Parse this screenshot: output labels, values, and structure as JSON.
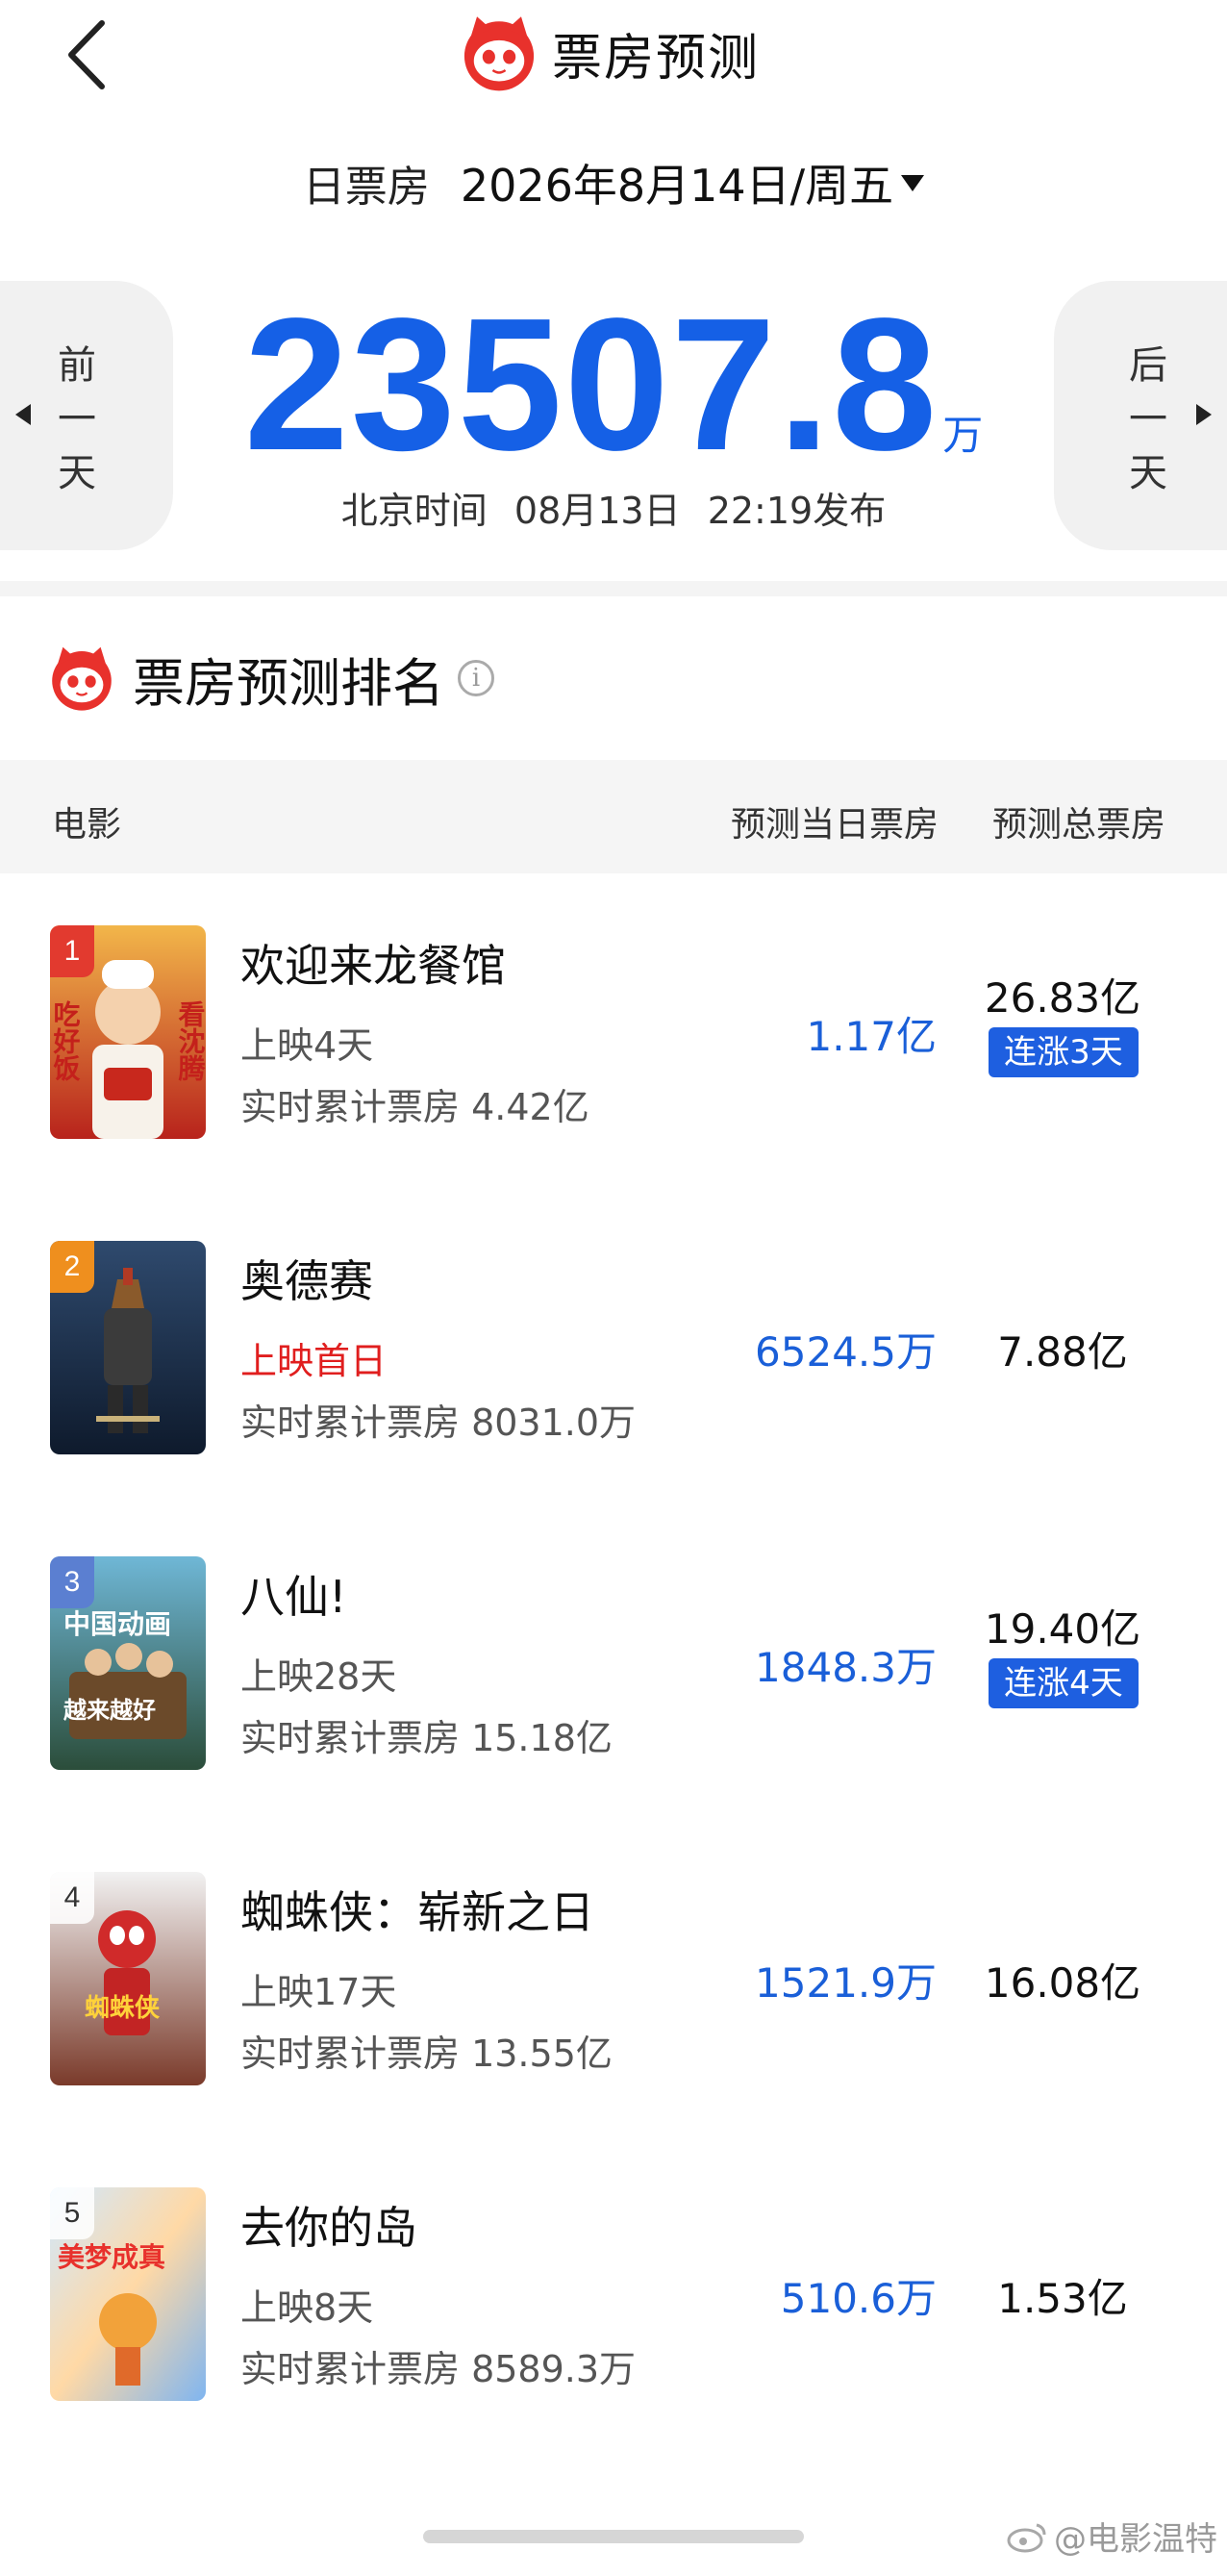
{
  "header": {
    "title": "票房预测"
  },
  "date_row": {
    "label": "日票房",
    "value": "2026年8月14日/周五"
  },
  "summary": {
    "prev_label": "前一天",
    "next_label": "后一天",
    "total": "23507.8",
    "unit": "万",
    "publish_tz": "北京时间",
    "publish_date": "08月13日",
    "publish_time": "22:19发布"
  },
  "section": {
    "title": "票房预测排名"
  },
  "table_header": {
    "movie": "电影",
    "day": "预测当日票房",
    "total": "预测总票房"
  },
  "movies": [
    {
      "rank": "1",
      "title": "欢迎来龙餐馆",
      "days": "上映4天",
      "cum": "实时累计票房 4.42亿",
      "day_bo": "1.17亿",
      "total_bo": "26.83亿",
      "badge": "连涨3天",
      "poster_text": [
        "吃好饭",
        "看沈腾"
      ]
    },
    {
      "rank": "2",
      "title": "奥德赛",
      "days": "上映首日",
      "cum": "实时累计票房 8031.0万",
      "day_bo": "6524.5万",
      "total_bo": "7.88亿",
      "badge": ""
    },
    {
      "rank": "3",
      "title": "八仙!",
      "days": "上映28天",
      "cum": "实时累计票房 15.18亿",
      "day_bo": "1848.3万",
      "total_bo": "19.40亿",
      "badge": "连涨4天",
      "poster_text": [
        "中国动画",
        "越来越好"
      ]
    },
    {
      "rank": "4",
      "title": "蜘蛛侠：崭新之日",
      "days": "上映17天",
      "cum": "实时累计票房 13.55亿",
      "day_bo": "1521.9万",
      "total_bo": "16.08亿",
      "badge": "",
      "poster_text": [
        "蜘蛛侠"
      ]
    },
    {
      "rank": "5",
      "title": "去你的岛",
      "days": "上映8天",
      "cum": "实时累计票房 8589.3万",
      "day_bo": "510.6万",
      "total_bo": "1.53亿",
      "badge": "",
      "poster_text": [
        "美梦成真"
      ]
    }
  ],
  "watermark": "@电影温特",
  "colors": {
    "accent": "#1560e6",
    "badge": "#1e5fe0",
    "brand_red": "#e8312c",
    "first_day_red": "#e01e1e"
  }
}
